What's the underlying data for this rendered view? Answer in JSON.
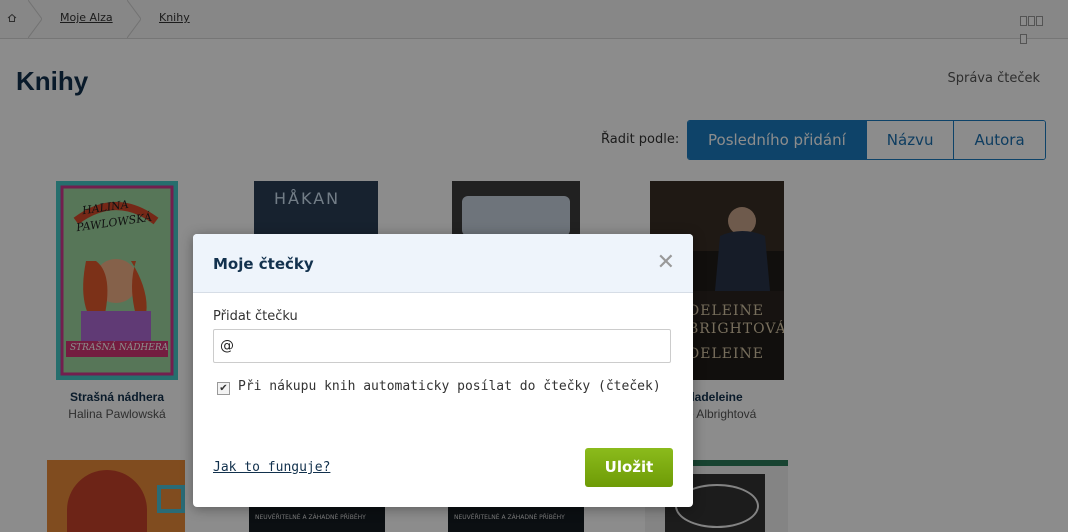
{
  "breadcrumb": {
    "home_icon": "home-icon",
    "items": [
      "Moje Alza",
      "Knihy"
    ]
  },
  "header": {
    "title": "Knihy",
    "manage_readers": "Správa čteček"
  },
  "sort": {
    "label": "Řadit podle:",
    "options": [
      "Posledního přidání",
      "Názvu",
      "Autora"
    ],
    "active": "Posledního přidání"
  },
  "books": [
    {
      "title": "Strašná nádhera",
      "author": "Halina Pawlowská",
      "cover_text": "HALINA PAWLOWSKÁ · STRAŠNÁ NÁDHERA"
    },
    {
      "title": "",
      "author": "",
      "cover_text": "HÅKAN"
    },
    {
      "title": "",
      "author": "",
      "cover_text": ""
    },
    {
      "title": "ladeleine",
      "author": "ine Albrightová",
      "cover_text": "DELEINE BRIGHTOVÁ DELEINE"
    }
  ],
  "bottom_covers": [
    "NEUVĚŘITELNÉ A ZÁHADNÉ PŘÍBĚHY",
    "NEUVĚŘITELNÉ A ZÁHADNÉ PŘÍBĚHY"
  ],
  "modal": {
    "title": "Moje čtečky",
    "add_label": "Přidat čtečku",
    "input_value": "@",
    "checkbox_label": "Při nákupu knih automaticky posílat do čtečky (čteček)",
    "checkbox_checked": true,
    "help_link": "Jak to funguje?",
    "save_label": "Uložit"
  }
}
